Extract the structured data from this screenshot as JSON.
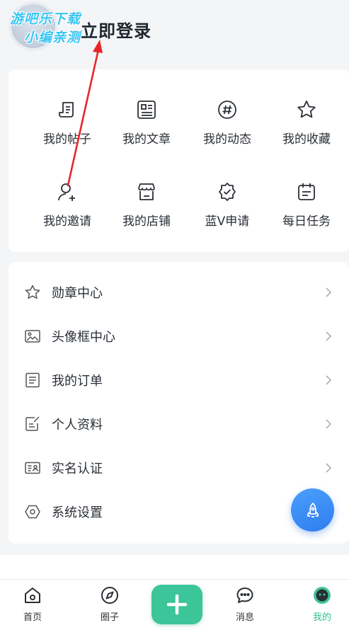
{
  "header": {
    "login_title": "立即登录",
    "watermark_line1": "游吧乐下载",
    "watermark_line2": "小编亲测"
  },
  "grid_items": [
    {
      "label": "我的帖子",
      "icon": "post-icon"
    },
    {
      "label": "我的文章",
      "icon": "article-icon"
    },
    {
      "label": "我的动态",
      "icon": "hashtag-icon"
    },
    {
      "label": "我的收藏",
      "icon": "star-icon"
    },
    {
      "label": "我的邀请",
      "icon": "invite-user-icon"
    },
    {
      "label": "我的店铺",
      "icon": "store-icon"
    },
    {
      "label": "蓝V申请",
      "icon": "verified-badge-icon"
    },
    {
      "label": "每日任务",
      "icon": "calendar-icon"
    }
  ],
  "list_items": [
    {
      "label": "勋章中心",
      "icon": "star-outline-icon"
    },
    {
      "label": "头像框中心",
      "icon": "image-frame-icon"
    },
    {
      "label": "我的订单",
      "icon": "order-list-icon"
    },
    {
      "label": "个人资料",
      "icon": "edit-profile-icon"
    },
    {
      "label": "实名认证",
      "icon": "id-card-icon"
    },
    {
      "label": "系统设置",
      "icon": "settings-hexagon-icon"
    }
  ],
  "tabbar": {
    "items": [
      {
        "label": "首页",
        "icon": "home-icon"
      },
      {
        "label": "圈子",
        "icon": "compass-icon"
      },
      {
        "label": "消息",
        "icon": "chat-icon"
      },
      {
        "label": "我的",
        "icon": "profile-face-icon",
        "active": true
      }
    ],
    "center": {
      "icon": "plus-icon"
    }
  },
  "colors": {
    "accent_green": "#3cc598",
    "fab_blue": "#3a8ef6",
    "annotation_arrow": "#e8262a"
  }
}
